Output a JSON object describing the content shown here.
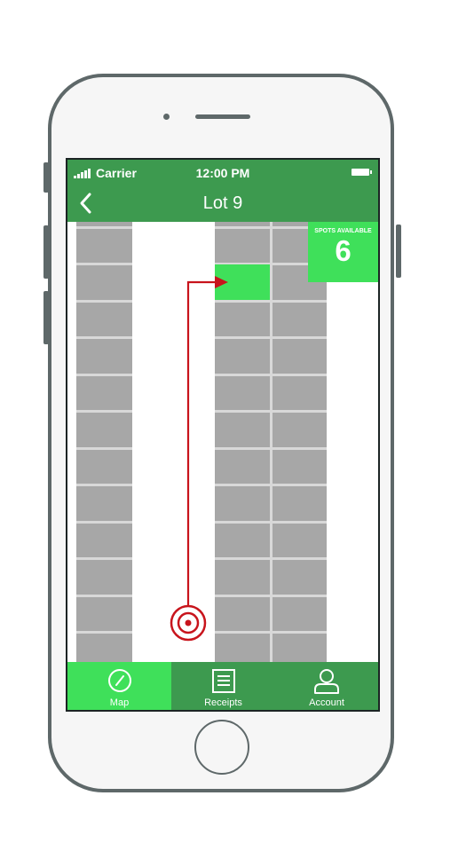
{
  "status_bar": {
    "carrier": "Carrier",
    "time": "12:00 PM"
  },
  "nav": {
    "title": "Lot 9",
    "back_icon": "chevron-left-icon"
  },
  "spots": {
    "label": "SPOTS AVAILABLE",
    "count": "6"
  },
  "tabs": [
    {
      "label": "Map",
      "icon": "compass-icon",
      "active": true
    },
    {
      "label": "Receipts",
      "icon": "receipt-icon",
      "active": false
    },
    {
      "label": "Account",
      "icon": "user-icon",
      "active": false
    }
  ],
  "colors": {
    "header_green": "#3d9a4f",
    "highlight_green": "#3fe05a",
    "route_red": "#c8141c",
    "slot_gray": "#a7a7a7",
    "phone_frame": "#5e6869"
  }
}
